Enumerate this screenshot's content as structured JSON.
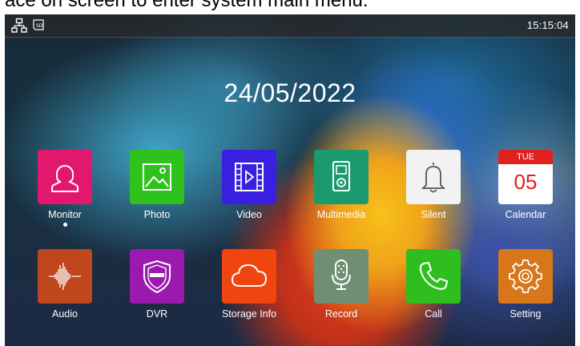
{
  "caption": "ace on screen to enter system main menu.",
  "status_bar": {
    "clock": "15:15:04",
    "icons": [
      "network-icon",
      "sd-card-icon"
    ]
  },
  "date": "24/05/2022",
  "apps": [
    {
      "label": "Monitor",
      "icon": "person-icon",
      "color": "#e2186e",
      "selected": true
    },
    {
      "label": "Photo",
      "icon": "picture-icon",
      "color": "#2fc21c"
    },
    {
      "label": "Video",
      "icon": "film-play-icon",
      "color": "#3a1fe0"
    },
    {
      "label": "Multimedia",
      "icon": "media-player-icon",
      "color": "#1a9a6e"
    },
    {
      "label": "Silent",
      "icon": "bell-icon",
      "color": "#f2f2f2"
    },
    {
      "label": "Calendar",
      "icon": "calendar-icon",
      "color": "#ffffff",
      "weekday": "TUE",
      "day": "05"
    },
    {
      "label": "Audio",
      "icon": "waveform-icon",
      "color": "#c0461e"
    },
    {
      "label": "DVR",
      "icon": "shield-icon",
      "color": "#9a1ab0"
    },
    {
      "label": "Storage Info",
      "icon": "cloud-icon",
      "color": "#f0450e"
    },
    {
      "label": "Record",
      "icon": "microphone-icon",
      "color": "#6f8f72"
    },
    {
      "label": "Call",
      "icon": "phone-icon",
      "color": "#2ebf1e"
    },
    {
      "label": "Setting",
      "icon": "gear-icon",
      "color": "#d8761a"
    }
  ]
}
